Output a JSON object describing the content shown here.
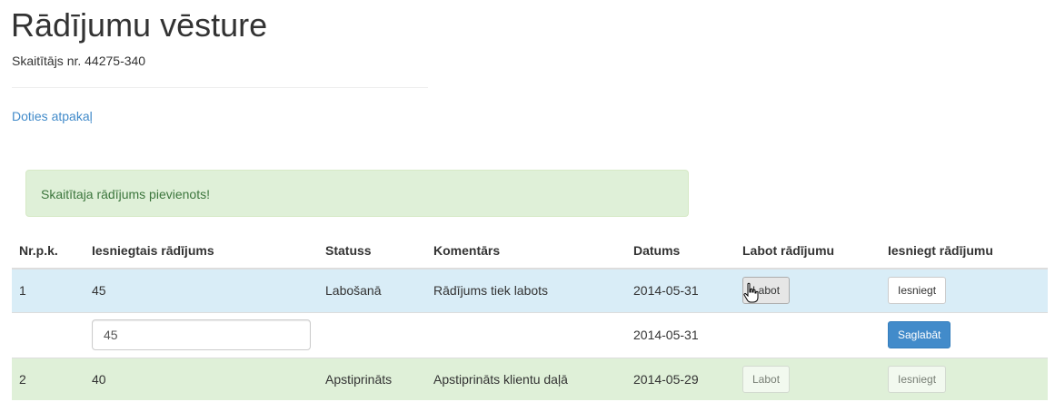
{
  "header": {
    "title": "Rādījumu vēsture",
    "meter_label": "Skaitītājs nr. 44275-340"
  },
  "nav": {
    "back_link": "Doties atpakaļ"
  },
  "alert": {
    "message": "Skaitītaja rādījums pievienots!",
    "status_color": "#dff0d8"
  },
  "table": {
    "columns": [
      "Nr.p.k.",
      "Iesniegtais rādījums",
      "Statuss",
      "Komentārs",
      "Datums",
      "Labot rādījumu",
      "Iesniegt rādījumu"
    ],
    "rows": [
      {
        "nr": "1",
        "reading": "45",
        "status": "Labošanā",
        "comment": "Rādījums tiek labots",
        "date": "2014-05-31",
        "edit_label": "Labot",
        "submit_label": "Iesniegt",
        "row_color": "#d9edf7"
      },
      {
        "edit_value": "45",
        "date": "2014-05-31",
        "save_label": "Saglabāt"
      },
      {
        "nr": "2",
        "reading": "40",
        "status": "Apstiprināts",
        "comment": "Apstiprināts klientu daļā",
        "date": "2014-05-29",
        "edit_label": "Labot",
        "submit_label": "Iesniegt",
        "row_color": "#dff0d8"
      }
    ]
  },
  "colors": {
    "link": "#428bca",
    "primary_button": "#428bca"
  }
}
